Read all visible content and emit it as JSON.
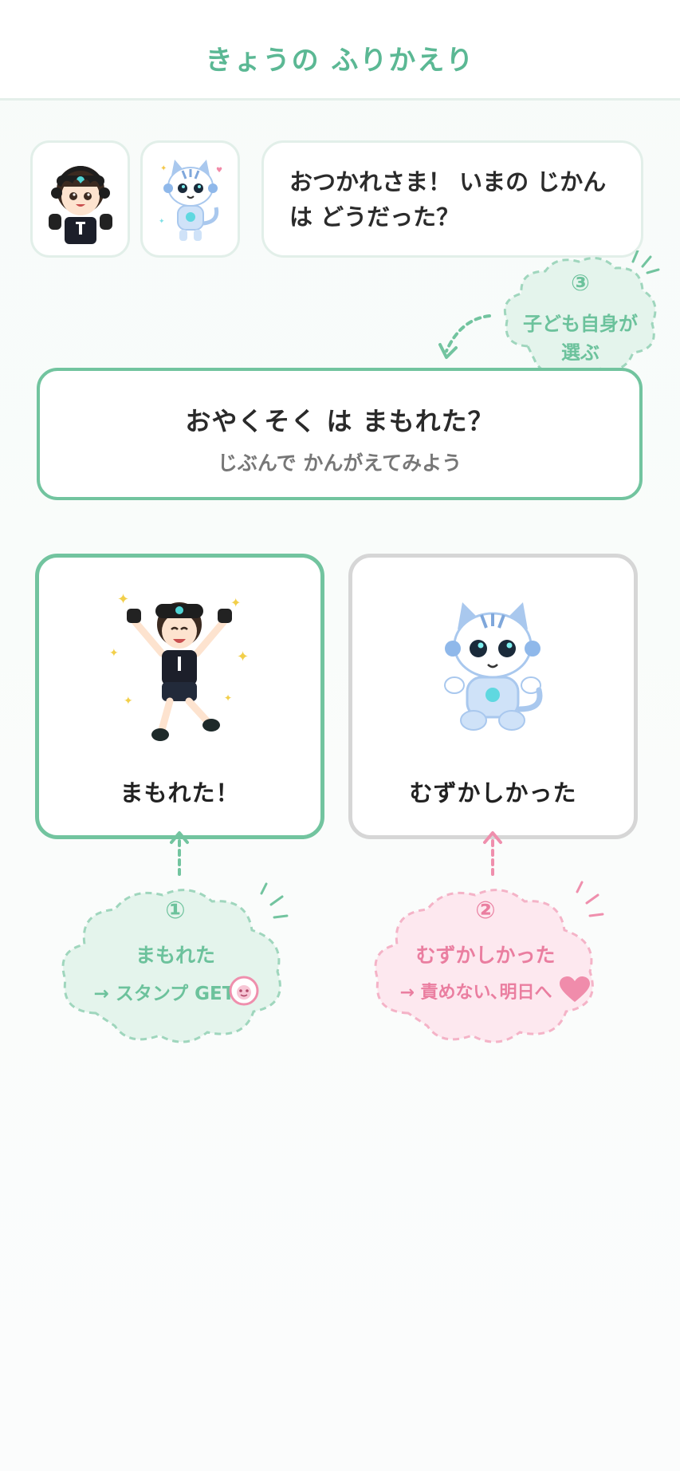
{
  "header": {
    "title": "きょうの ふりかえり"
  },
  "chat": {
    "message": "おつかれさま！ いまの じかんは どうだった？"
  },
  "question": {
    "title": "おやくそく は まもれた？",
    "subtitle": "じぶんで かんがえてみよう"
  },
  "choices": [
    {
      "label": "まもれた！"
    },
    {
      "label": "むずかしかった"
    }
  ],
  "annotations": {
    "note1": {
      "number": "①",
      "line1": "まもれた",
      "line2": "→ スタンプ GET"
    },
    "note2": {
      "number": "②",
      "line1": "むずかしかった",
      "line2": "→ 責めない､明日へ"
    },
    "note3": {
      "number": "③",
      "line1": "子ども自身が",
      "line2": "選ぶ"
    }
  },
  "colors": {
    "accent": "#5bb894",
    "accent_light": "#e4f4ec",
    "pink": "#ef8fad",
    "pink_light": "#fde8ef",
    "gray_border": "#d6d6d6"
  },
  "icons": [
    "boy-avatar-icon",
    "robot-cat-avatar-icon",
    "jumping-boy-icon",
    "sitting-robot-cat-icon",
    "stamp-face-icon",
    "heart-icon"
  ]
}
